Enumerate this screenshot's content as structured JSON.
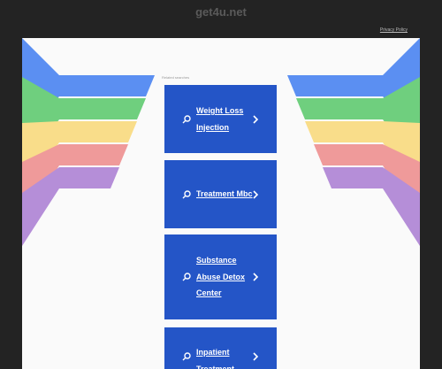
{
  "header": {
    "site_title": "get4u.net",
    "privacy_label": "Privacy Policy"
  },
  "section_label": "Related searches",
  "results": [
    {
      "label": "Weight Loss Injection"
    },
    {
      "label": "Treatment Mbc"
    },
    {
      "label": "Substance Abuse Detox Center"
    },
    {
      "label": "Inpatient Treatment"
    }
  ],
  "colors": {
    "page_bg": "#232323",
    "panel_bg": "#fafafa",
    "card_bg": "#2455c7",
    "stripes": [
      "#5b8ff2",
      "#6fcf7e",
      "#a9dd7f",
      "#f9dd8a",
      "#ef9a9a",
      "#b58ed8"
    ]
  },
  "icons": [
    "search-icon",
    "chevron-right-icon"
  ]
}
